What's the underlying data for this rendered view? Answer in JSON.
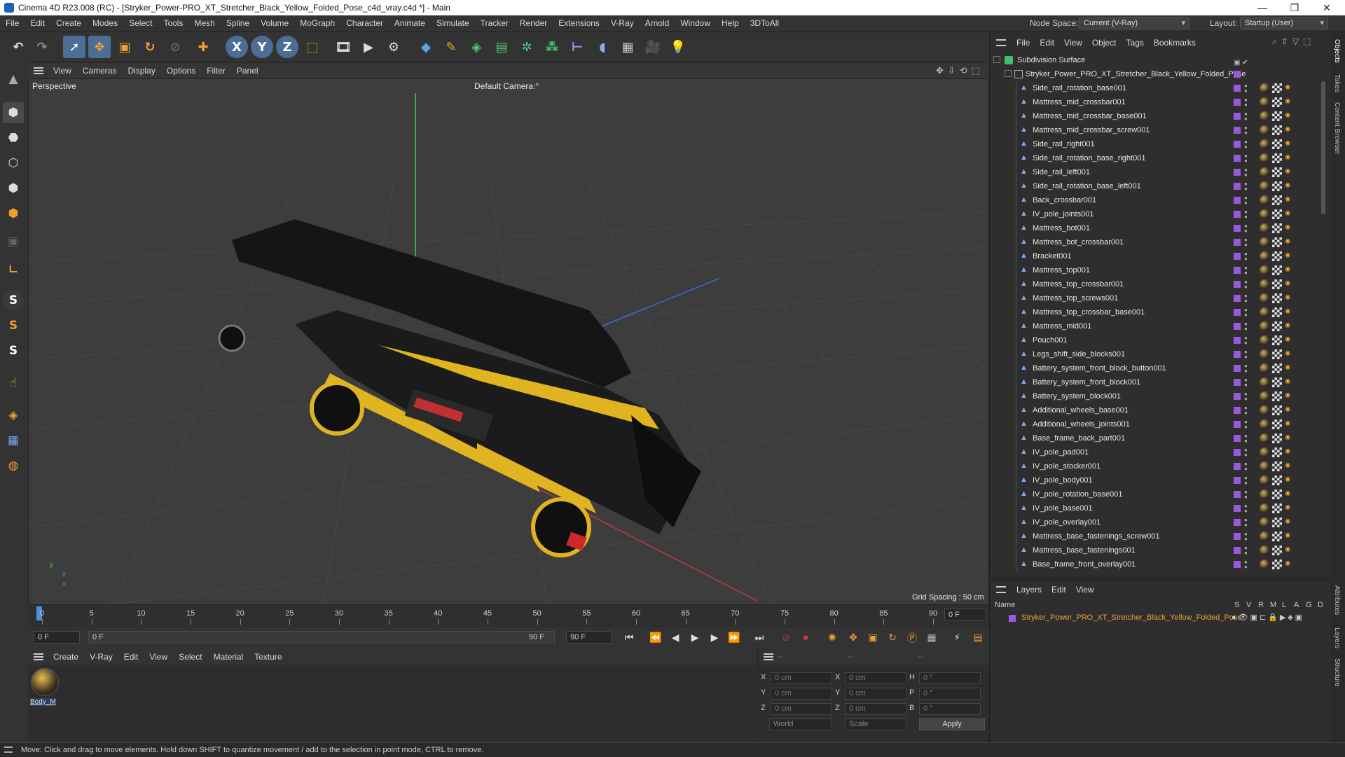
{
  "window": {
    "title": "Cinema 4D R23.008 (RC) - [Stryker_Power-PRO_XT_Stretcher_Black_Yellow_Folded_Pose_c4d_vray.c4d *] - Main",
    "minimize": "—",
    "maximize": "❐",
    "close": "✕"
  },
  "menubar": {
    "items": [
      "File",
      "Edit",
      "Create",
      "Modes",
      "Select",
      "Tools",
      "Mesh",
      "Spline",
      "Volume",
      "MoGraph",
      "Character",
      "Animate",
      "Simulate",
      "Tracker",
      "Render",
      "Extensions",
      "V-Ray",
      "Arnold",
      "Window",
      "Help",
      "3DToAll"
    ],
    "node_space_label": "Node Space:",
    "node_space_value": "Current (V-Ray)",
    "layout_label": "Layout:",
    "layout_value": "Startup (User)"
  },
  "viewport": {
    "menu": [
      "View",
      "Cameras",
      "Display",
      "Options",
      "Filter",
      "Panel"
    ],
    "view_name": "Perspective",
    "camera": "Default Camera",
    "camera_suffix": ":°",
    "grid_spacing": "Grid Spacing : 50 cm",
    "axis_y": "y",
    "axis_z": "z",
    "axis_x": "x"
  },
  "timeline": {
    "ticks": [
      "0",
      "5",
      "10",
      "15",
      "20",
      "25",
      "30",
      "35",
      "40",
      "45",
      "50",
      "55",
      "60",
      "65",
      "70",
      "75",
      "80",
      "85",
      "90"
    ],
    "current_frame": "0 F"
  },
  "transport": {
    "start": "0 F",
    "range_start": "0 F",
    "range_end": "90 F",
    "end": "90 F"
  },
  "material": {
    "menu": [
      "Create",
      "V-Ray",
      "Edit",
      "View",
      "Select",
      "Material",
      "Texture"
    ],
    "item_label": "Body_M"
  },
  "coordinates": {
    "header": [
      "--",
      "--",
      "--"
    ],
    "rows": [
      {
        "l1": "X",
        "v1": "0 cm",
        "l2": "X",
        "v2": "0 cm",
        "l3": "H",
        "v3": "0 °"
      },
      {
        "l1": "Y",
        "v1": "0 cm",
        "l2": "Y",
        "v2": "0 cm",
        "l3": "P",
        "v3": "0 °"
      },
      {
        "l1": "Z",
        "v1": "0 cm",
        "l2": "Z",
        "v2": "0 cm",
        "l3": "B",
        "v3": "0 °"
      }
    ],
    "world": "World",
    "scale": "Scale",
    "apply": "Apply"
  },
  "objects": {
    "menu": [
      "File",
      "Edit",
      "View",
      "Object",
      "Tags",
      "Bookmarks"
    ],
    "root": "Subdivision Surface",
    "group": "Stryker_Power_PRO_XT_Stretcher_Black_Yellow_Folded_Pose",
    "items": [
      "Side_rail_rotation_base001",
      "Mattress_mid_crossbar001",
      "Mattress_mid_crossbar_base001",
      "Mattress_mid_crossbar_screw001",
      "Side_rail_right001",
      "Side_rail_rotation_base_right001",
      "Side_rail_left001",
      "Side_rail_rotation_base_left001",
      "Back_crossbar001",
      "IV_pole_joints001",
      "Mattress_bot001",
      "Mattress_bot_crossbar001",
      "Bracket001",
      "Mattress_top001",
      "Mattress_top_crossbar001",
      "Mattress_top_screws001",
      "Mattress_top_crossbar_base001",
      "Mattress_mid001",
      "Pouch001",
      "Legs_shift_side_blocks001",
      "Battery_system_front_block_button001",
      "Battery_system_front_block001",
      "Battery_system_block001",
      "Additional_wheels_base001",
      "Additional_wheels_joints001",
      "Base_frame_back_part001",
      "IV_pole_pad001",
      "IV_pole_stocker001",
      "IV_pole_body001",
      "IV_pole_rotation_base001",
      "IV_pole_base001",
      "IV_pole_overlay001",
      "Mattress_base_fastenings_screw001",
      "Mattress_base_fastenings001",
      "Base_frame_front_overlay001"
    ]
  },
  "layers": {
    "menu": [
      "Layers",
      "Edit",
      "View"
    ],
    "col_name": "Name",
    "cols": [
      "S",
      "V",
      "R",
      "M",
      "L",
      "A",
      "G",
      "D"
    ],
    "item": "Stryker_Power_PRO_XT_Stretcher_Black_Yellow_Folded_Pose"
  },
  "right_tabs": [
    "Objects",
    "Takes",
    "Content Browser",
    "Attributes",
    "Layers",
    "Structure"
  ],
  "status": "Move: Click and drag to move elements. Hold down SHIFT to quantize movement / add to the selection in point mode, CTRL to remove.",
  "colors": {
    "accent": "#4a90e2",
    "layer_orange": "#e8a23c",
    "object_purple": "#9b57e0"
  }
}
